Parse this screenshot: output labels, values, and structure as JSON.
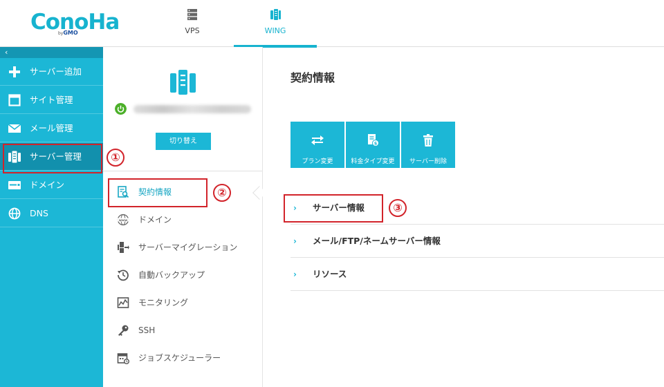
{
  "logo": {
    "text": "ConoHa",
    "by": "by",
    "brand": "GMO"
  },
  "header_tabs": [
    {
      "label": "VPS",
      "icon": "server-stack-icon"
    },
    {
      "label": "WING",
      "icon": "phone-server-icon",
      "active": true
    }
  ],
  "sidebar": {
    "collapse_glyph": "‹",
    "items": [
      {
        "label": "サーバー追加",
        "icon": "plus-icon"
      },
      {
        "label": "サイト管理",
        "icon": "window-icon"
      },
      {
        "label": "メール管理",
        "icon": "mail-icon"
      },
      {
        "label": "サーバー管理",
        "icon": "server-icon",
        "active": true
      },
      {
        "label": "ドメイン",
        "icon": "domain-icon"
      },
      {
        "label": "DNS",
        "icon": "globe-icon"
      }
    ]
  },
  "server_panel": {
    "switch_label": "切り替え"
  },
  "submenu": [
    {
      "label": "契約情報",
      "icon": "contract-search-icon",
      "active": true
    },
    {
      "label": "ドメイン",
      "icon": "www-globe-icon"
    },
    {
      "label": "サーバーマイグレーション",
      "icon": "migration-icon"
    },
    {
      "label": "自動バックアップ",
      "icon": "backup-clock-icon"
    },
    {
      "label": "モニタリング",
      "icon": "monitor-chart-icon"
    },
    {
      "label": "SSH",
      "icon": "key-icon"
    },
    {
      "label": "ジョブスケジューラー",
      "icon": "calendar-icon"
    }
  ],
  "main": {
    "title": "契約情報",
    "actions": [
      {
        "label": "プラン変更",
        "icon": "swap-arrows-icon"
      },
      {
        "label": "料金タイプ変更",
        "icon": "billing-type-icon"
      },
      {
        "label": "サーバー削除",
        "icon": "trash-icon"
      }
    ],
    "sections": [
      {
        "label": "サーバー情報",
        "chevron": "›"
      },
      {
        "label": "メール/FTP/ネームサーバー情報",
        "chevron": "›"
      },
      {
        "label": "リソース",
        "chevron": "›"
      }
    ]
  },
  "annotations": [
    "①",
    "②",
    "③"
  ],
  "colors": {
    "accent": "#1cb7d6",
    "sidebar_active": "#1290ad",
    "annotation": "#d2232a",
    "power": "#4cb02a"
  }
}
